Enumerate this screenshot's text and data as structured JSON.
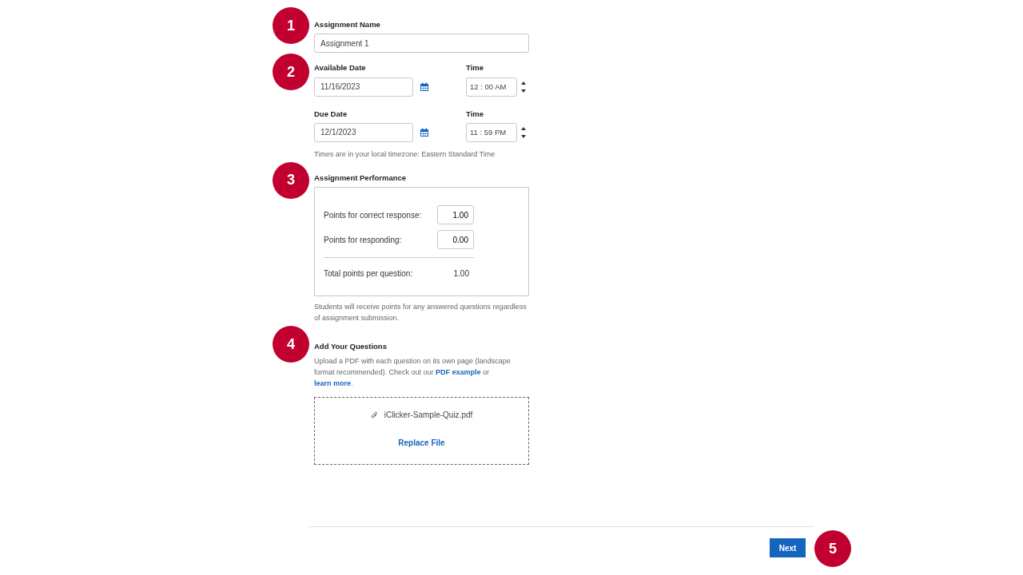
{
  "name_section": {
    "callout": "1",
    "label": "Assignment Name",
    "value": "Assignment 1"
  },
  "dates_section": {
    "callout": "2",
    "rows": [
      {
        "date_label": "Available Date",
        "date_value": "11/16/2023",
        "time_label": "Time",
        "time_value": "12 : 00 AM"
      },
      {
        "date_label": "Due Date",
        "date_value": "12/1/2023",
        "time_label": "Time",
        "time_value": "11 : 59 PM"
      }
    ],
    "note": "Times are in your local timezone: Eastern Standard Time"
  },
  "performance_section": {
    "callout": "3",
    "label": "Assignment Performance",
    "fields": [
      {
        "label": "Points for correct response:",
        "value": "1.00"
      },
      {
        "label": "Points for responding:",
        "value": "0.00"
      }
    ],
    "total_label": "Total points per question:",
    "total_value": "1.00",
    "note": "Students will receive points for any answered questions regardless of assignment submission."
  },
  "questions_section": {
    "callout": "4",
    "label": "Add Your Questions",
    "description": [
      {
        "kind": "text",
        "text": "Upload a PDF with each question on its own page (landscape format recommended). Check out our "
      },
      {
        "kind": "link",
        "text": "PDF example"
      },
      {
        "kind": "text",
        "text": " or "
      },
      {
        "kind": "link",
        "text": "learn more"
      },
      {
        "kind": "text",
        "text": "."
      }
    ],
    "file_name": "iClicker-Sample-Quiz.pdf",
    "replace_link": "Replace File"
  },
  "footer": {
    "button": "Next",
    "callout": "5"
  }
}
